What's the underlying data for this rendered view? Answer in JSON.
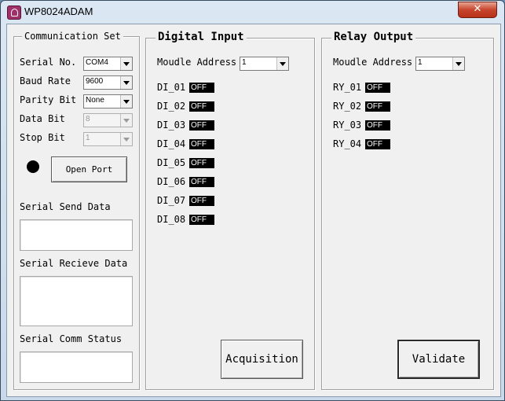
{
  "window": {
    "title": "WP8024ADAM",
    "close_symbol": "✕"
  },
  "communication": {
    "group_title": "Communication Set",
    "serial_no": {
      "label": "Serial No.",
      "value": "COM4"
    },
    "baud_rate": {
      "label": "Baud Rate",
      "value": "9600"
    },
    "parity_bit": {
      "label": "Parity Bit",
      "value": "None"
    },
    "data_bit": {
      "label": "Data Bit",
      "value": "8"
    },
    "stop_bit": {
      "label": "Stop Bit",
      "value": "1"
    },
    "open_port_label": "Open Port",
    "indicator_color": "#000000",
    "send_label": "Serial Send Data",
    "send_value": "",
    "receive_label": "Serial Recieve Data",
    "receive_value": "",
    "status_label": "Serial Comm Status",
    "status_value": ""
  },
  "digital_input": {
    "group_title": "Digital Input",
    "address_label": "Moudle Address",
    "address_value": "1",
    "channels": [
      {
        "label": "DI_01",
        "state": "OFF"
      },
      {
        "label": "DI_02",
        "state": "OFF"
      },
      {
        "label": "DI_03",
        "state": "OFF"
      },
      {
        "label": "DI_04",
        "state": "OFF"
      },
      {
        "label": "DI_05",
        "state": "OFF"
      },
      {
        "label": "DI_06",
        "state": "OFF"
      },
      {
        "label": "DI_07",
        "state": "OFF"
      },
      {
        "label": "DI_08",
        "state": "OFF"
      }
    ],
    "button_label": "Acquisition"
  },
  "relay_output": {
    "group_title": "Relay Output",
    "address_label": "Moudle Address",
    "address_value": "1",
    "channels": [
      {
        "label": "RY_01",
        "state": "OFF"
      },
      {
        "label": "RY_02",
        "state": "OFF"
      },
      {
        "label": "RY_03",
        "state": "OFF"
      },
      {
        "label": "RY_04",
        "state": "OFF"
      }
    ],
    "button_label": "Validate"
  }
}
